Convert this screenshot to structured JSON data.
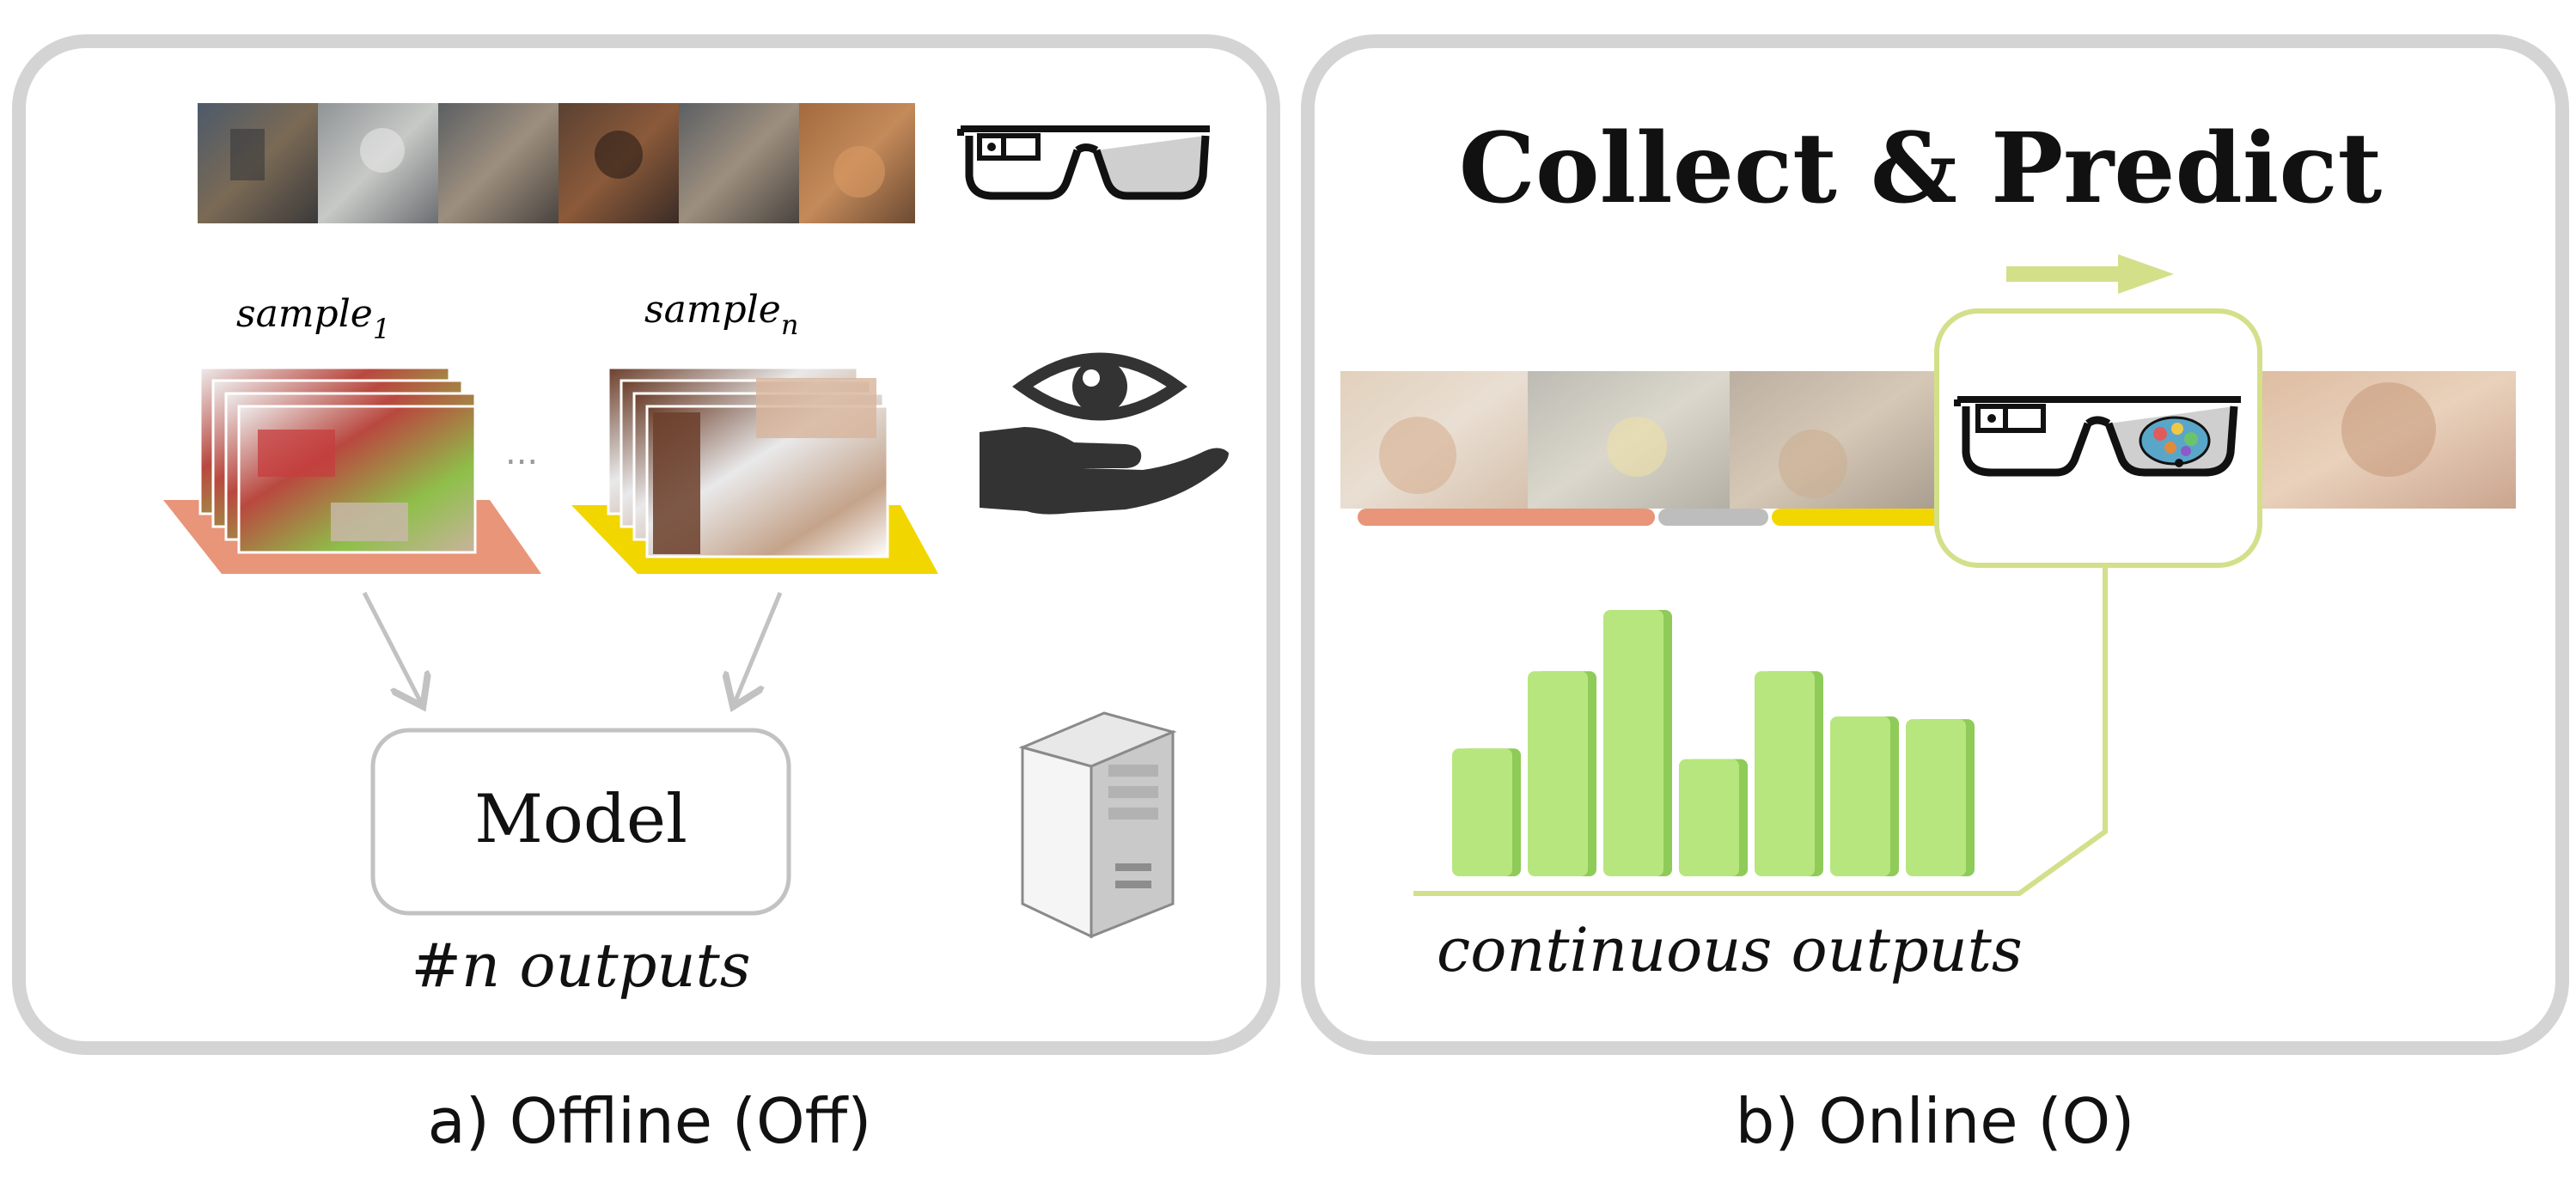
{
  "panel_offline": {
    "caption": "a) Offline (Off)",
    "sample_first_base": "sample",
    "sample_first_sub": "1",
    "sample_last_base": "sample",
    "sample_last_sub": "n",
    "ellipsis": "...",
    "model_label": "Model",
    "outputs_label": "#n outputs",
    "icons": [
      "smart-glasses-icon",
      "eye-hand-icon",
      "server-tower-icon"
    ]
  },
  "panel_online": {
    "caption": "b) Online (O)",
    "title": "Collect & Predict",
    "outputs_label": "continuous outputs",
    "icons": [
      "smart-glasses-brain-icon",
      "progress-arrow-icon"
    ]
  },
  "colors": {
    "panel_border": "#d4d4d4",
    "salmon": "#e8957a",
    "gray_segment": "#bdbdbd",
    "yellow": "#f2d600",
    "olive_line": "#d4df8a",
    "bar_green": "#b7e67e",
    "bar_green_dark": "#8fcb58"
  },
  "online_bar_levels": [
    0.48,
    0.77,
    1.0,
    0.44,
    0.77,
    0.6,
    0.59
  ]
}
